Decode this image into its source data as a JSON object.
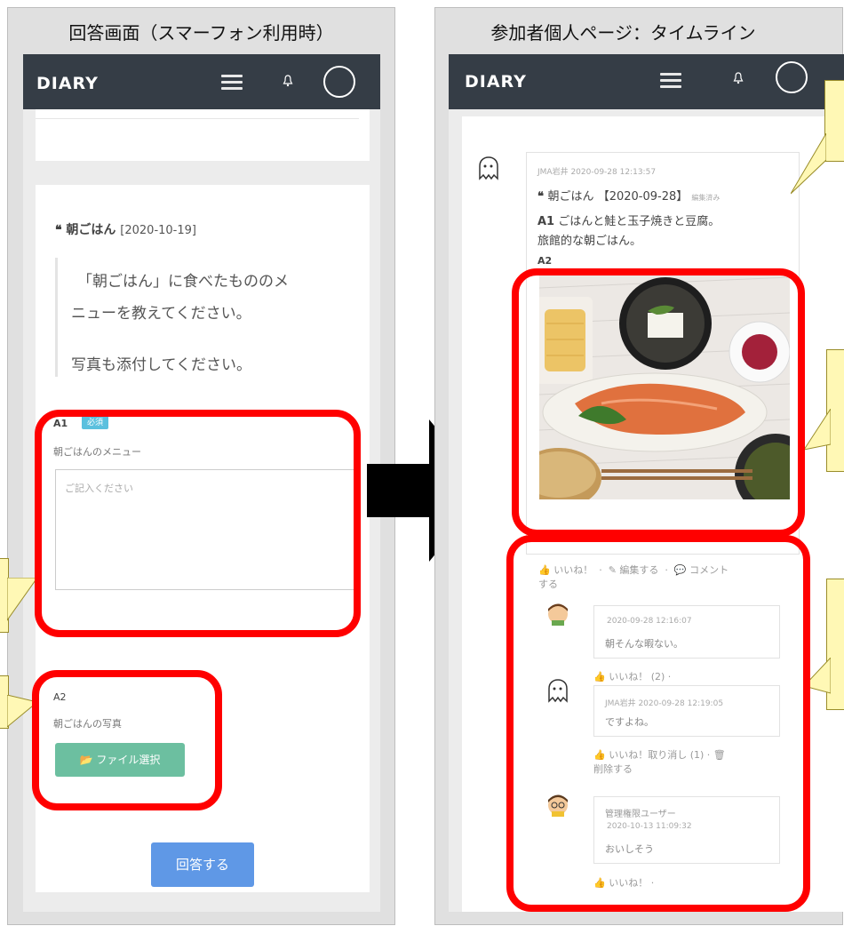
{
  "left": {
    "caption": "回答画面（スマーフォン利用時）",
    "app_name": "DIARY",
    "question_title": "朝ごはん",
    "question_date": "[2020-10-19]",
    "question_body_1": "「朝ごはん」に食べたもののメ",
    "question_body_2": "ニューを教えてください。",
    "question_body_3": "写真も添付してください。",
    "a1_label": "A1",
    "required_badge": "必須",
    "a1_field_label": "朝ごはんのメニュー",
    "a1_placeholder": "ご記入ください",
    "a2_label": "A2",
    "a2_field_label": "朝ごはんの写真",
    "file_button": "ファイル選択",
    "submit_button": "回答する"
  },
  "right": {
    "caption": "参加者個人ページ：タイムライン",
    "app_name": "DIARY",
    "post_author": "JMA岩井",
    "post_time": "2020-09-28 12:13:57",
    "post_title": "朝ごはん",
    "post_date": "【2020-09-28】",
    "edited": "編集済み",
    "a1_label": "A1",
    "a1_text_1": "ごはんと鮭と玉子焼きと豆腐。",
    "a1_text_2": "旅館的な朝ごはん。",
    "a2_label": "A2",
    "actions_like": "いいね！",
    "actions_edit": "編集する",
    "actions_comment": "コメント",
    "actions_comment_2": "する",
    "comments": [
      {
        "author": "",
        "time": "2020-09-28 12:16:07",
        "text": "朝そんな暇ない。",
        "footer": "いいね！ (2)"
      },
      {
        "author": "JMA岩井",
        "time": "2020-09-28 12:19:05",
        "text": "ですよね。",
        "footer": "いいね！取り消し (1)",
        "footer_2": "削除する"
      },
      {
        "author": "管理権限ユーザー",
        "time": "2020-10-13 11:09:32",
        "text": "おいしそう",
        "footer": "いいね！"
      }
    ]
  },
  "colors": {
    "red": "#ff0000",
    "appbar": "#353d46",
    "badge": "#5bc0de",
    "file_button": "#6cbfa0",
    "submit_button": "#5f98e6",
    "callout": "#fff8b5"
  }
}
